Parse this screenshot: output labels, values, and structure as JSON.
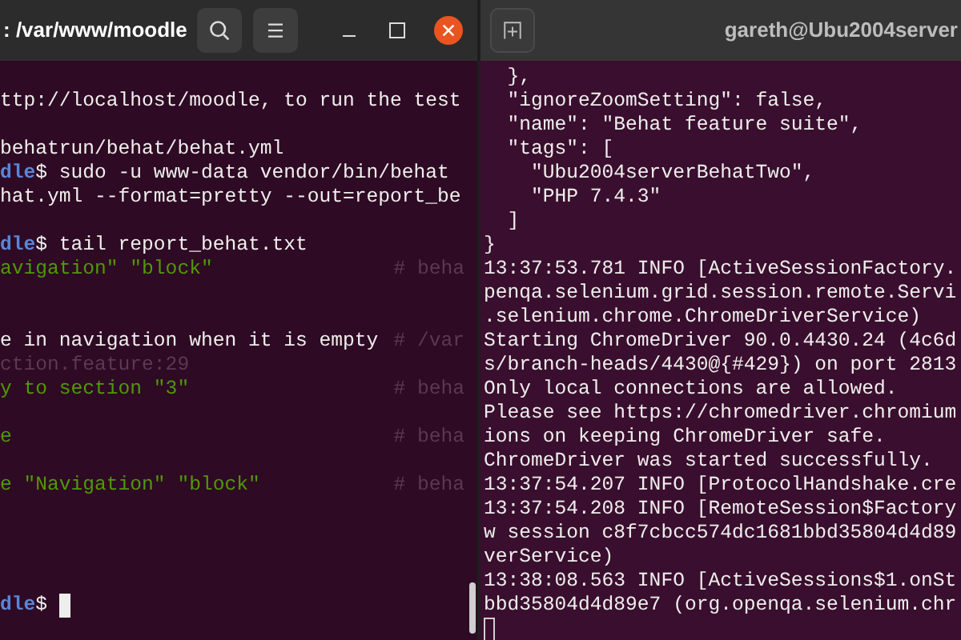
{
  "windows": [
    {
      "title": ": /var/www/moodle",
      "active": true,
      "lines": [
        {
          "kind": "blank"
        },
        {
          "kind": "text",
          "segments": [
            {
              "kind": "plain",
              "text": "ttp://localhost/moodle, to run the test"
            }
          ]
        },
        {
          "kind": "blank"
        },
        {
          "kind": "text",
          "segments": [
            {
              "kind": "plain",
              "text": "behatrun/behat/behat.yml"
            }
          ]
        },
        {
          "kind": "text",
          "segments": [
            {
              "kind": "prompt",
              "text": "dle"
            },
            {
              "kind": "plain",
              "text": "$ sudo -u www-data vendor/bin/behat"
            }
          ]
        },
        {
          "kind": "text",
          "segments": [
            {
              "kind": "plain",
              "text": "hat.yml --format=pretty --out=report_be"
            }
          ]
        },
        {
          "kind": "blank"
        },
        {
          "kind": "text",
          "segments": [
            {
              "kind": "prompt",
              "text": "dle"
            },
            {
              "kind": "plain",
              "text": "$ tail report_behat.txt"
            }
          ]
        },
        {
          "kind": "text",
          "segments": [
            {
              "kind": "passed",
              "text": "avigation\" \"block\""
            }
          ],
          "comment": "# beha"
        },
        {
          "kind": "blank"
        },
        {
          "kind": "blank"
        },
        {
          "kind": "text",
          "segments": [
            {
              "kind": "plain",
              "text": "e in navigation when it is empty"
            }
          ],
          "comment": "# /var"
        },
        {
          "kind": "text",
          "segments": [
            {
              "kind": "dim",
              "text": "ction.feature:29"
            }
          ]
        },
        {
          "kind": "text",
          "segments": [
            {
              "kind": "passed",
              "text": "y to section \"3\""
            }
          ],
          "comment": "# beha"
        },
        {
          "kind": "blank"
        },
        {
          "kind": "text",
          "segments": [
            {
              "kind": "passed",
              "text": "e"
            }
          ],
          "comment": "# beha"
        },
        {
          "kind": "blank"
        },
        {
          "kind": "text",
          "segments": [
            {
              "kind": "passed",
              "text": "e \"Navigation\" \"block\""
            }
          ],
          "comment": "# beha"
        },
        {
          "kind": "blank"
        },
        {
          "kind": "blank"
        },
        {
          "kind": "blank"
        },
        {
          "kind": "blank"
        },
        {
          "kind": "text",
          "segments": [
            {
              "kind": "prompt",
              "text": "dle"
            },
            {
              "kind": "plain",
              "text": "$ "
            }
          ],
          "cursor": true
        }
      ]
    },
    {
      "title": "gareth@Ubu2004server",
      "active": false,
      "lines": [
        {
          "kind": "text",
          "segments": [
            {
              "kind": "plain",
              "text": "  },"
            }
          ]
        },
        {
          "kind": "text",
          "segments": [
            {
              "kind": "plain",
              "text": "  \"ignoreZoomSetting\": false,"
            }
          ]
        },
        {
          "kind": "text",
          "segments": [
            {
              "kind": "plain",
              "text": "  \"name\": \"Behat feature suite\","
            }
          ]
        },
        {
          "kind": "text",
          "segments": [
            {
              "kind": "plain",
              "text": "  \"tags\": ["
            }
          ]
        },
        {
          "kind": "text",
          "segments": [
            {
              "kind": "plain",
              "text": "    \"Ubu2004serverBehatTwo\","
            }
          ]
        },
        {
          "kind": "text",
          "segments": [
            {
              "kind": "plain",
              "text": "    \"PHP 7.4.3\""
            }
          ]
        },
        {
          "kind": "text",
          "segments": [
            {
              "kind": "plain",
              "text": "  ]"
            }
          ]
        },
        {
          "kind": "text",
          "segments": [
            {
              "kind": "plain",
              "text": "}"
            }
          ]
        },
        {
          "kind": "text",
          "segments": [
            {
              "kind": "plain",
              "text": "13:37:53.781 INFO [ActiveSessionFactory."
            }
          ]
        },
        {
          "kind": "text",
          "segments": [
            {
              "kind": "plain",
              "text": "penqa.selenium.grid.session.remote.Servi"
            }
          ]
        },
        {
          "kind": "text",
          "segments": [
            {
              "kind": "plain",
              "text": ".selenium.chrome.ChromeDriverService)"
            }
          ]
        },
        {
          "kind": "text",
          "segments": [
            {
              "kind": "plain",
              "text": "Starting ChromeDriver 90.0.4430.24 (4c6d"
            }
          ]
        },
        {
          "kind": "text",
          "segments": [
            {
              "kind": "plain",
              "text": "s/branch-heads/4430@{#429}) on port 2813"
            }
          ]
        },
        {
          "kind": "text",
          "segments": [
            {
              "kind": "plain",
              "text": "Only local connections are allowed."
            }
          ]
        },
        {
          "kind": "text",
          "segments": [
            {
              "kind": "plain",
              "text": "Please see https://chromedriver.chromium"
            }
          ]
        },
        {
          "kind": "text",
          "segments": [
            {
              "kind": "plain",
              "text": "ions on keeping ChromeDriver safe."
            }
          ]
        },
        {
          "kind": "text",
          "segments": [
            {
              "kind": "plain",
              "text": "ChromeDriver was started successfully."
            }
          ]
        },
        {
          "kind": "text",
          "segments": [
            {
              "kind": "plain",
              "text": "13:37:54.207 INFO [ProtocolHandshake.cre"
            }
          ]
        },
        {
          "kind": "text",
          "segments": [
            {
              "kind": "plain",
              "text": "13:37:54.208 INFO [RemoteSession$Factory"
            }
          ]
        },
        {
          "kind": "text",
          "segments": [
            {
              "kind": "plain",
              "text": "w session c8f7cbcc574dc1681bbd35804d4d89"
            }
          ]
        },
        {
          "kind": "text",
          "segments": [
            {
              "kind": "plain",
              "text": "verService)"
            }
          ]
        },
        {
          "kind": "text",
          "segments": [
            {
              "kind": "plain",
              "text": "13:38:08.563 INFO [ActiveSessions$1.onSt"
            }
          ]
        },
        {
          "kind": "text",
          "segments": [
            {
              "kind": "plain",
              "text": "bbd35804d4d89e7 (org.openqa.selenium.chr"
            }
          ]
        },
        {
          "kind": "cursor"
        }
      ]
    }
  ]
}
